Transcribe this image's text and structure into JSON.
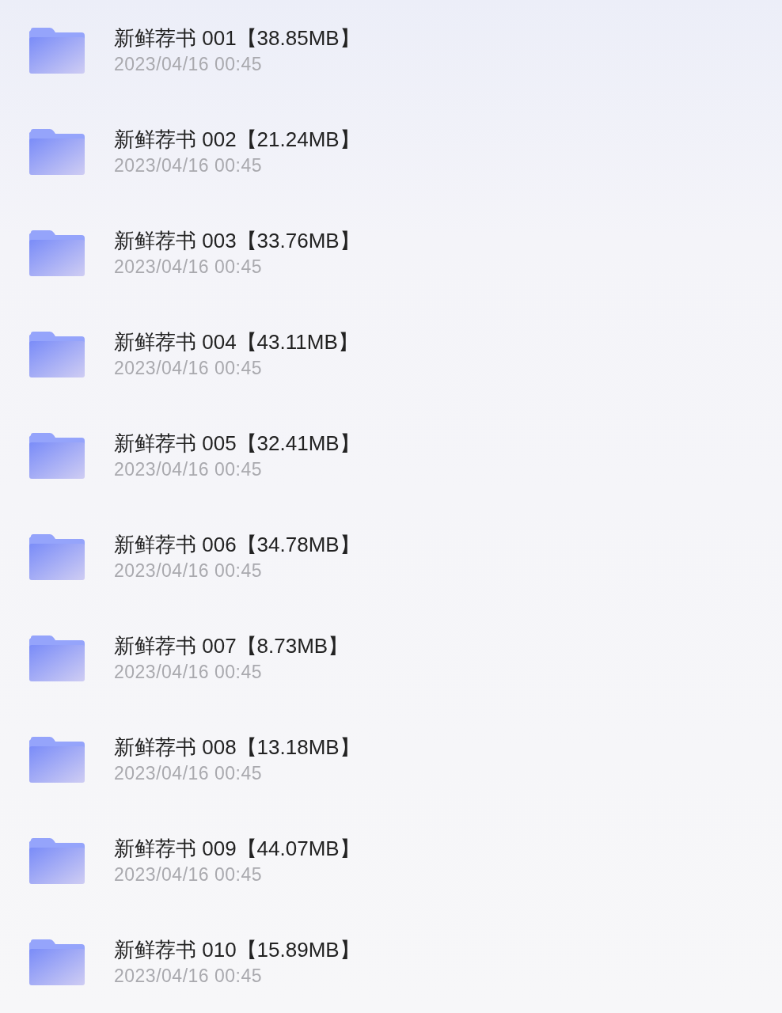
{
  "files": [
    {
      "name": "新鲜荐书 001【38.85MB】",
      "date": "2023/04/16 00:45"
    },
    {
      "name": "新鲜荐书 002【21.24MB】",
      "date": "2023/04/16 00:45"
    },
    {
      "name": "新鲜荐书 003【33.76MB】",
      "date": "2023/04/16 00:45"
    },
    {
      "name": "新鲜荐书 004【43.11MB】",
      "date": "2023/04/16 00:45"
    },
    {
      "name": "新鲜荐书 005【32.41MB】",
      "date": "2023/04/16 00:45"
    },
    {
      "name": "新鲜荐书 006【34.78MB】",
      "date": "2023/04/16 00:45"
    },
    {
      "name": "新鲜荐书 007【8.73MB】",
      "date": "2023/04/16 00:45"
    },
    {
      "name": "新鲜荐书 008【13.18MB】",
      "date": "2023/04/16 00:45"
    },
    {
      "name": "新鲜荐书 009【44.07MB】",
      "date": "2023/04/16 00:45"
    },
    {
      "name": "新鲜荐书 010【15.89MB】",
      "date": "2023/04/16 00:45"
    }
  ]
}
